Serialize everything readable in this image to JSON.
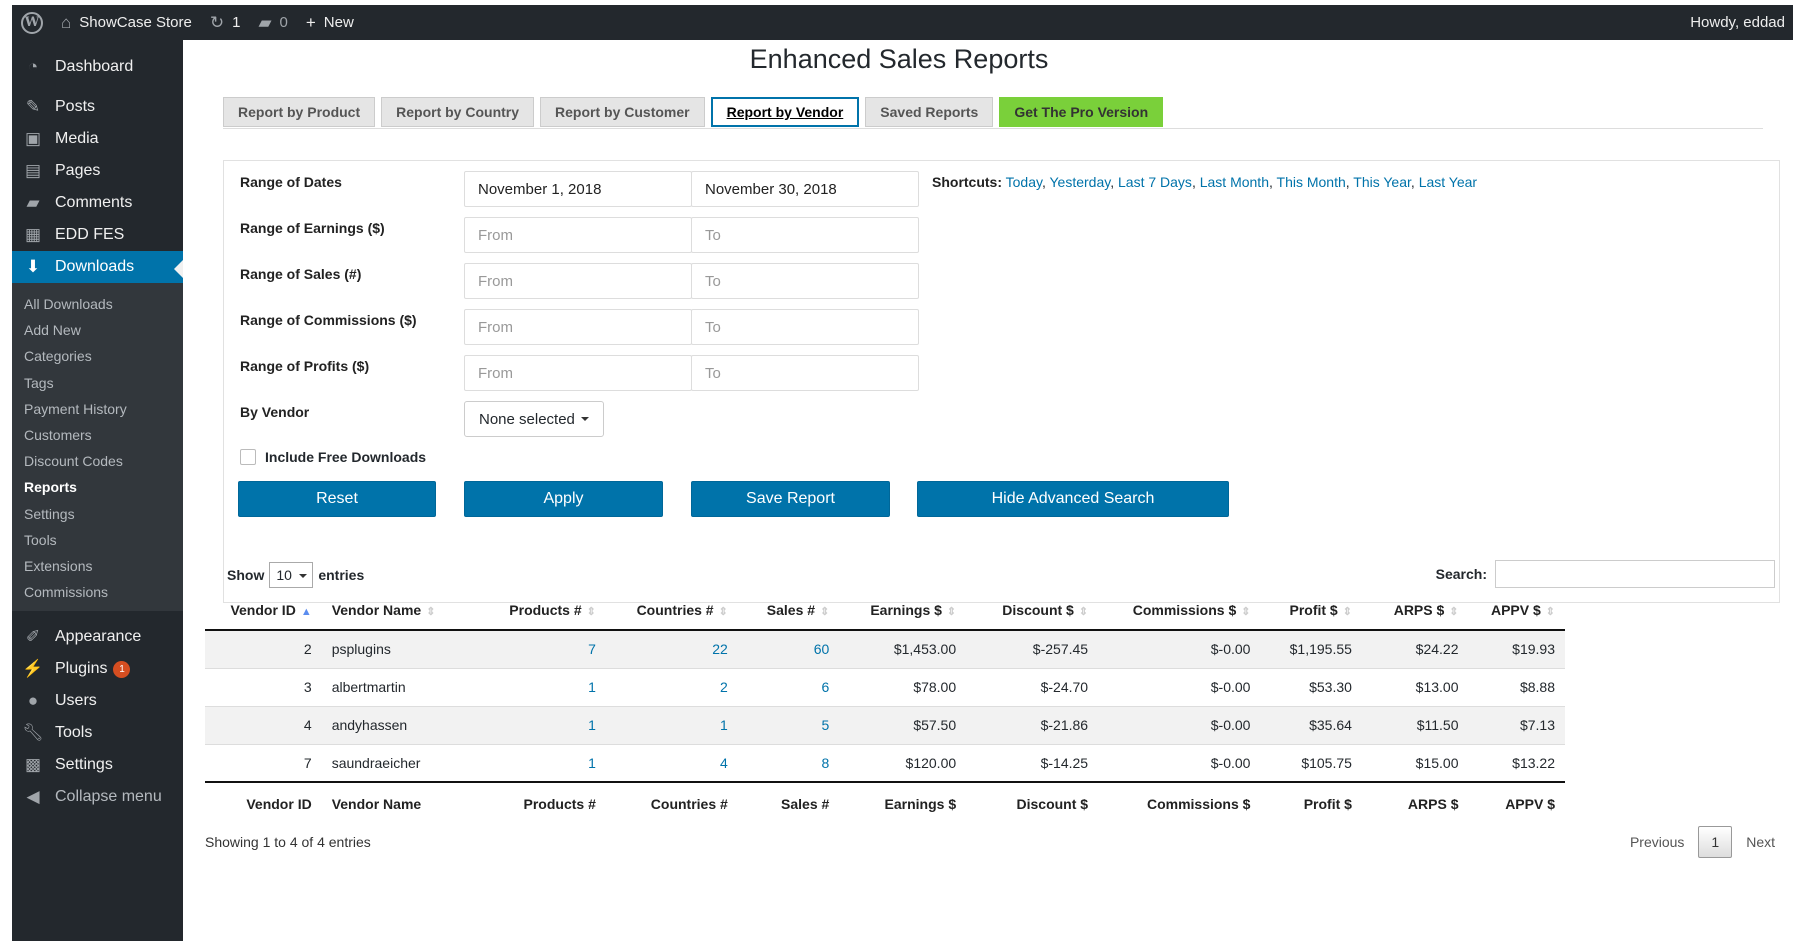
{
  "adminbar": {
    "site_name": "ShowCase Store",
    "updates_count": "1",
    "comments_count": "0",
    "new_label": "New",
    "howdy": "Howdy, eddad"
  },
  "sidebar": {
    "items": [
      {
        "label": "Dashboard",
        "icon": "dashboard-icon"
      },
      {
        "label": "Posts",
        "icon": "pin-icon"
      },
      {
        "label": "Media",
        "icon": "media-icon"
      },
      {
        "label": "Pages",
        "icon": "pages-icon"
      },
      {
        "label": "Comments",
        "icon": "comment-icon"
      },
      {
        "label": "EDD FES",
        "icon": "store-icon"
      },
      {
        "label": "Downloads",
        "icon": "download-icon"
      }
    ],
    "submenu": [
      "All Downloads",
      "Add New",
      "Categories",
      "Tags",
      "Payment History",
      "Customers",
      "Discount Codes",
      "Reports",
      "Settings",
      "Tools",
      "Extensions",
      "Commissions"
    ],
    "bottom_items": [
      {
        "label": "Appearance",
        "icon": "brush-icon"
      },
      {
        "label": "Plugins",
        "icon": "plug-icon",
        "badge": "1"
      },
      {
        "label": "Users",
        "icon": "user-icon"
      },
      {
        "label": "Tools",
        "icon": "wrench-icon"
      },
      {
        "label": "Settings",
        "icon": "settings-icon"
      },
      {
        "label": "Collapse menu",
        "icon": "collapse-icon"
      }
    ]
  },
  "page": {
    "title": "Enhanced Sales Reports",
    "tabs": [
      "Report by Product",
      "Report by Country",
      "Report by Customer",
      "Report by Vendor",
      "Saved Reports",
      "Get The Pro Version"
    ]
  },
  "filters": {
    "range_dates_label": "Range of Dates",
    "date_from": "November 1, 2018",
    "date_to": "November 30, 2018",
    "earnings_label": "Range of Earnings ($)",
    "sales_label": "Range of Sales (#)",
    "commissions_label": "Range of Commissions ($)",
    "profits_label": "Range of Profits ($)",
    "from_placeholder": "From",
    "to_placeholder": "To",
    "vendor_label": "By Vendor",
    "vendor_value": "None selected",
    "include_free_label": "Include Free Downloads",
    "shortcuts_label": "Shortcuts:",
    "shortcuts": [
      "Today",
      "Yesterday",
      "Last 7 Days",
      "Last Month",
      "This Month",
      "This Year",
      "Last Year"
    ]
  },
  "buttons": {
    "reset": "Reset",
    "apply": "Apply",
    "save_report": "Save Report",
    "hide_advanced": "Hide Advanced Search"
  },
  "table": {
    "show_label": "Show",
    "entries_value": "10",
    "entries_label": "entries",
    "search_label": "Search:",
    "columns": [
      "Vendor ID",
      "Vendor Name",
      "Products #",
      "Countries #",
      "Sales #",
      "Earnings $",
      "Discount $",
      "Commissions $",
      "Profit $",
      "ARPS $",
      "APPV $"
    ],
    "rows": [
      [
        "2",
        "psplugins",
        "7",
        "22",
        "60",
        "$1,453.00",
        "$-257.45",
        "$-0.00",
        "$1,195.55",
        "$24.22",
        "$19.93"
      ],
      [
        "3",
        "albertmartin",
        "1",
        "2",
        "6",
        "$78.00",
        "$-24.70",
        "$-0.00",
        "$53.30",
        "$13.00",
        "$8.88"
      ],
      [
        "4",
        "andyhassen",
        "1",
        "1",
        "5",
        "$57.50",
        "$-21.86",
        "$-0.00",
        "$35.64",
        "$11.50",
        "$7.13"
      ],
      [
        "7",
        "saundraeicher",
        "1",
        "4",
        "8",
        "$120.00",
        "$-14.25",
        "$-0.00",
        "$105.75",
        "$15.00",
        "$13.22"
      ]
    ],
    "info": "Showing 1 to 4 of 4 entries",
    "previous": "Previous",
    "current_page": "1",
    "next": "Next"
  }
}
